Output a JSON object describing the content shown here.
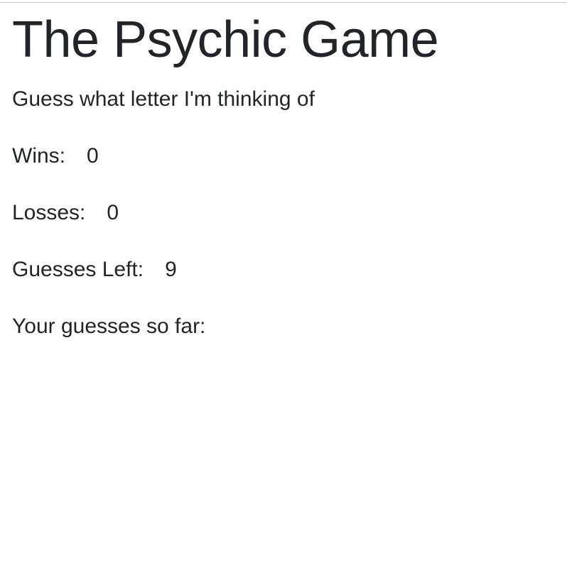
{
  "page": {
    "title": "The Psychic Game",
    "subtitle": "Guess what letter I'm thinking of"
  },
  "stats": {
    "wins_label": "Wins:",
    "wins_value": "0",
    "losses_label": "Losses:",
    "losses_value": "0",
    "guesses_left_label": "Guesses Left:",
    "guesses_left_value": "9",
    "guesses_so_far_label": "Your guesses so far:",
    "guesses_so_far_value": ""
  },
  "colors": {
    "text": "#212529",
    "background": "#ffffff",
    "top_rule": "#d0d0d0"
  }
}
